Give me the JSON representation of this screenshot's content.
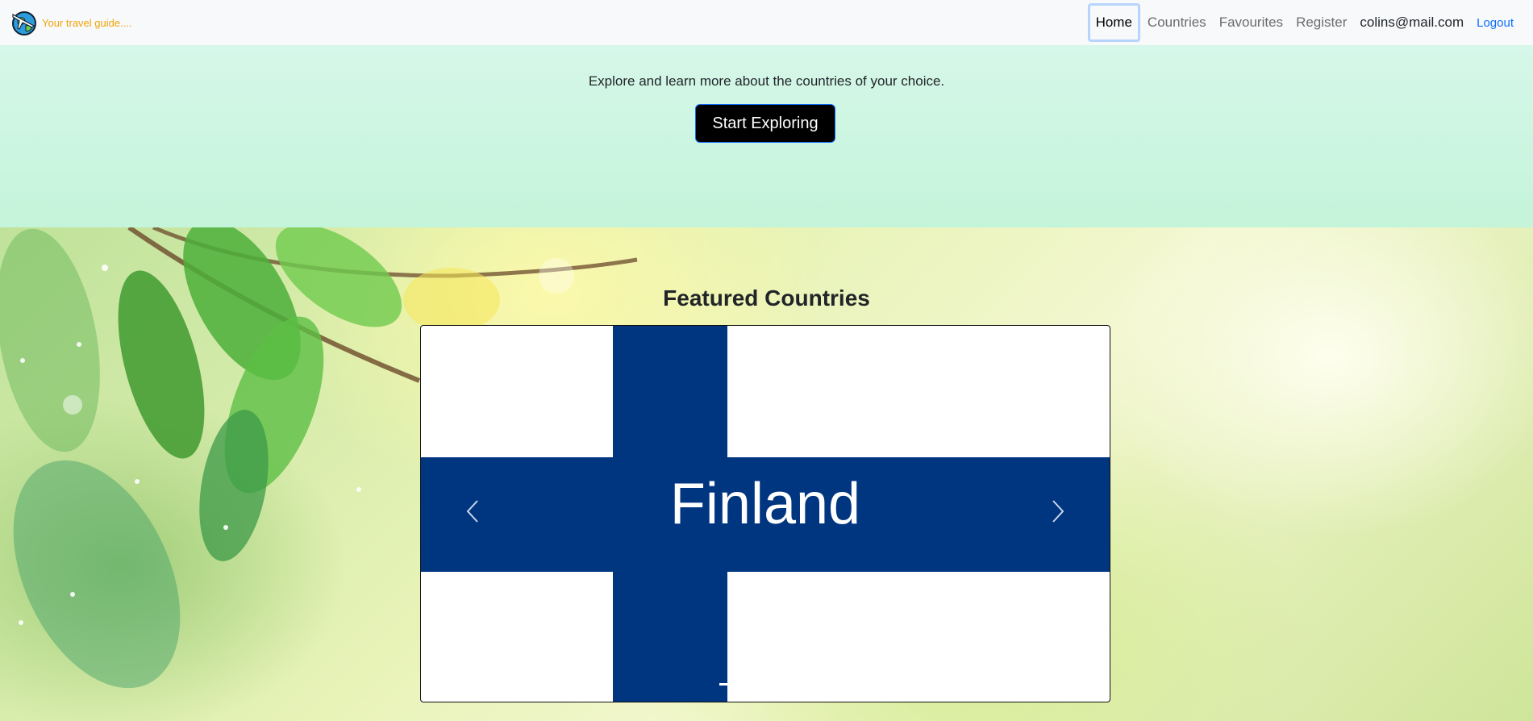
{
  "navbar": {
    "tagline": "Your travel guide....",
    "links": {
      "home": "Home",
      "countries": "Countries",
      "favourites": "Favourites",
      "register": "Register"
    },
    "user_email": "colins@mail.com",
    "logout": "Logout"
  },
  "hero": {
    "text": "Explore and learn more about the countries of your choice.",
    "button": "Start Exploring"
  },
  "featured": {
    "title": "Featured Countries",
    "slide": {
      "caption": "Finland",
      "flag_colors": {
        "cross": "#003580",
        "field": "#ffffff"
      }
    }
  },
  "colors": {
    "tagline": "#f0a30a",
    "accent": "#0d6efd",
    "navbar_bg": "#f8f9fa",
    "hero_bg": "#d2f6e5"
  }
}
